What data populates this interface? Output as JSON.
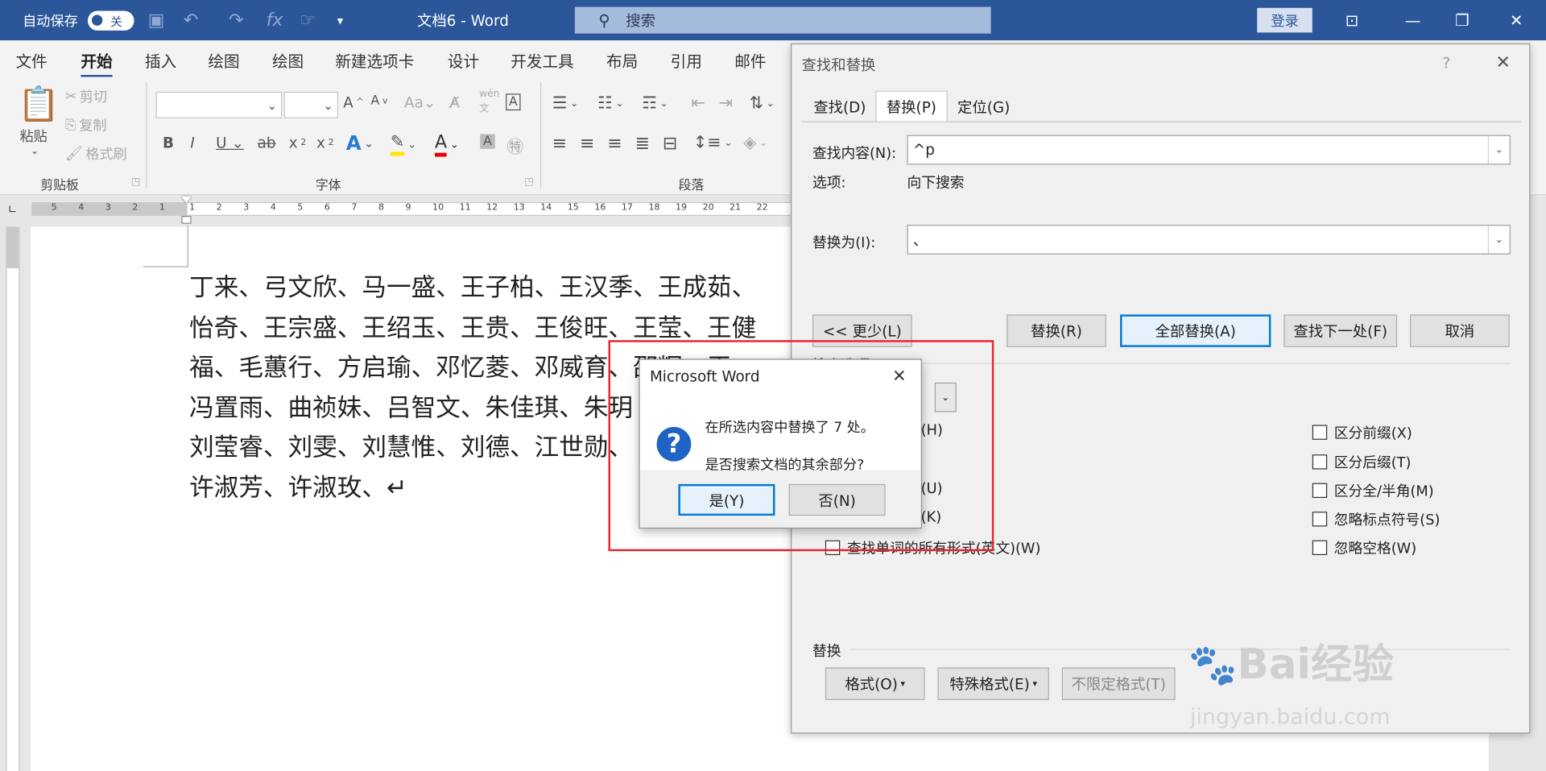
{
  "titlebar": {
    "autosave_label": "自动保存",
    "autosave_state": "关",
    "doc_title": "文档6 - Word",
    "search_placeholder": "搜索",
    "login": "登录"
  },
  "menu": [
    "文件",
    "开始",
    "插入",
    "绘图",
    "绘图",
    "新建选项卡",
    "设计",
    "开发工具",
    "布局",
    "引用",
    "邮件"
  ],
  "ribbon": {
    "paste": "粘贴",
    "cut": "剪切",
    "copy": "复制",
    "format_painter": "格式刷",
    "group_clipboard": "剪贴板",
    "group_font": "字体",
    "group_paragraph": "段落"
  },
  "ruler": {
    "ticks": [
      "5",
      "4",
      "3",
      "2",
      "1",
      "1",
      "2",
      "3",
      "4",
      "5",
      "6",
      "7",
      "8",
      "9",
      "10",
      "11",
      "12",
      "13",
      "14",
      "15",
      "16",
      "17",
      "18",
      "19",
      "20",
      "21",
      "22"
    ]
  },
  "document": {
    "lines": [
      "丁来、弓文欣、马一盛、王子柏、王汉季、王成茹、",
      "怡奇、王宗盛、王绍玉、王贵、王俊旺、王莹、王健",
      "福、毛蕙行、方启瑜、邓忆菱、邓威育、邵辉、王",
      "冯置雨、曲祯妹、吕智文、朱佳琪、朱玥",
      "刘莹睿、刘雯、刘慧惟、刘德、江世勋、",
      "许淑芳、许淑玫、↵"
    ]
  },
  "find_replace": {
    "title": "查找和替换",
    "help": "?",
    "tabs": [
      "查找(D)",
      "替换(P)",
      "定位(G)"
    ],
    "find_label": "查找内容(N):",
    "find_value": "^p",
    "options_label": "选项:",
    "options_value": "向下搜索",
    "replace_label": "替换为(I):",
    "replace_value": "、",
    "btn_less": "<< 更少(L)",
    "btn_replace": "替换(R)",
    "btn_replace_all": "全部替换(A)",
    "btn_find_next": "查找下一处(F)",
    "btn_cancel": "取消",
    "search_options_label": "搜索选项",
    "partial_left": [
      "(H)",
      "(U)",
      "(K)"
    ],
    "word_forms": "查找单词的所有形式(英文)(W)",
    "right_checks": [
      "区分前缀(X)",
      "区分后缀(T)",
      "区分全/半角(M)",
      "忽略标点符号(S)",
      "忽略空格(W)"
    ],
    "replace_section": "替换",
    "btn_format": "格式(O)",
    "btn_special": "特殊格式(E)",
    "btn_no_format": "不限定格式(T)"
  },
  "msgbox": {
    "title": "Microsoft Word",
    "line1": "在所选内容中替换了 7 处。",
    "line2": "是否搜索文档的其余部分?",
    "yes": "是(Y)",
    "no": "否(N)"
  },
  "watermark": {
    "brand": "Bai经验",
    "url": "jingyan.baidu.com"
  },
  "colors": {
    "titlebar": "#2b579a",
    "highlight": "#e8252a",
    "accent": "#0078d7"
  }
}
